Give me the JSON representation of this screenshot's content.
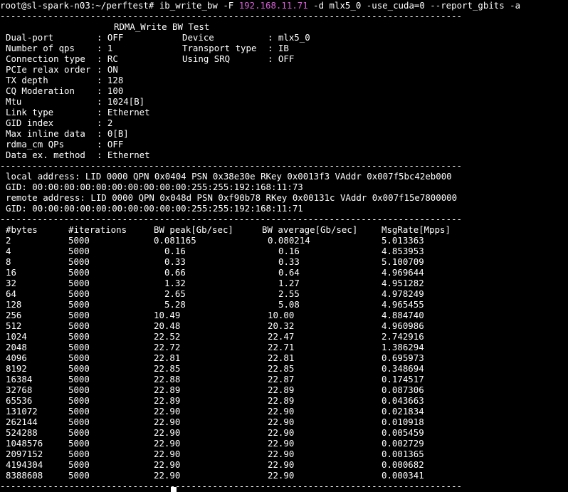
{
  "prompt": {
    "user_host_path": "root@sl-spark-n03:~/perftest#",
    "cmd_before_ip": "ib_write_bw -F",
    "ip": "192.168.11.71",
    "cmd_after_ip": "-d mlx5_0 -use_cuda=0 --report_gbits -a"
  },
  "separator": "---------------------------------------------------------------------------------------",
  "test_title": "RDMA_Write BW Test",
  "params_left": [
    {
      "key": "Dual-port",
      "value": ": OFF"
    },
    {
      "key": "Number of qps",
      "value": ": 1"
    },
    {
      "key": "Connection type",
      "value": ": RC"
    },
    {
      "key": "PCIe relax order",
      "value": ": ON"
    },
    {
      "key": "TX depth",
      "value": ": 128"
    },
    {
      "key": "CQ Moderation",
      "value": ": 100"
    },
    {
      "key": "Mtu",
      "value": ": 1024[B]"
    },
    {
      "key": "Link type",
      "value": ": Ethernet"
    },
    {
      "key": "GID index",
      "value": ": 2"
    },
    {
      "key": "Max inline data",
      "value": ": 0[B]"
    },
    {
      "key": "rdma_cm QPs",
      "value": ": OFF"
    },
    {
      "key": "Data ex. method",
      "value": ": Ethernet"
    }
  ],
  "params_right": [
    {
      "key": "Device",
      "value": ": mlx5_0"
    },
    {
      "key": "Transport type",
      "value": ": IB"
    },
    {
      "key": "Using SRQ",
      "value": ": OFF"
    }
  ],
  "connection": {
    "local": "local address: LID 0000 QPN 0x0404 PSN 0x38e30e RKey 0x0013f3 VAddr 0x007f5bc42eb000",
    "local_gid": "GID: 00:00:00:00:00:00:00:00:00:00:255:255:192:168:11:73",
    "remote": "remote address: LID 0000 QPN 0x048d PSN 0xf90b78 RKey 0x00131c VAddr 0x007f15e7800000",
    "remote_gid": "GID: 00:00:00:00:00:00:00:00:00:00:255:255:192:168:11:71"
  },
  "results": {
    "headers": [
      "#bytes",
      "#iterations",
      "BW peak[Gb/sec]",
      "BW average[Gb/sec]",
      "MsgRate[Mpps]"
    ],
    "rows": [
      [
        "2",
        "5000",
        "0.081165",
        "0.080214",
        "5.013363"
      ],
      [
        "4",
        "5000",
        "0.16",
        "0.16",
        "4.853953"
      ],
      [
        "8",
        "5000",
        "0.33",
        "0.33",
        "5.100709"
      ],
      [
        "16",
        "5000",
        "0.66",
        "0.64",
        "4.969644"
      ],
      [
        "32",
        "5000",
        "1.32",
        "1.27",
        "4.951282"
      ],
      [
        "64",
        "5000",
        "2.65",
        "2.55",
        "4.978249"
      ],
      [
        "128",
        "5000",
        "5.28",
        "5.08",
        "4.965455"
      ],
      [
        "256",
        "5000",
        "10.49",
        "10.00",
        "4.884740"
      ],
      [
        "512",
        "5000",
        "20.48",
        "20.32",
        "4.960986"
      ],
      [
        "1024",
        "5000",
        "22.52",
        "22.47",
        "2.742916"
      ],
      [
        "2048",
        "5000",
        "22.72",
        "22.71",
        "1.386294"
      ],
      [
        "4096",
        "5000",
        "22.81",
        "22.81",
        "0.695973"
      ],
      [
        "8192",
        "5000",
        "22.85",
        "22.85",
        "0.348694"
      ],
      [
        "16384",
        "5000",
        "22.88",
        "22.87",
        "0.174517"
      ],
      [
        "32768",
        "5000",
        "22.89",
        "22.89",
        "0.087306"
      ],
      [
        "65536",
        "5000",
        "22.89",
        "22.89",
        "0.043663"
      ],
      [
        "131072",
        "5000",
        "22.90",
        "22.90",
        "0.021834"
      ],
      [
        "262144",
        "5000",
        "22.90",
        "22.90",
        "0.010918"
      ],
      [
        "524288",
        "5000",
        "22.90",
        "22.90",
        "0.005459"
      ],
      [
        "1048576",
        "5000",
        "22.90",
        "22.90",
        "0.002729"
      ],
      [
        "2097152",
        "5000",
        "22.90",
        "22.90",
        "0.001365"
      ],
      [
        "4194304",
        "5000",
        "22.90",
        "22.90",
        "0.000682"
      ],
      [
        "8388608",
        "5000",
        "22.90",
        "22.90",
        "0.000341"
      ]
    ]
  },
  "colors": {
    "background": "#000000",
    "text": "#ffffff",
    "ip_highlight": "#d75fd7"
  }
}
